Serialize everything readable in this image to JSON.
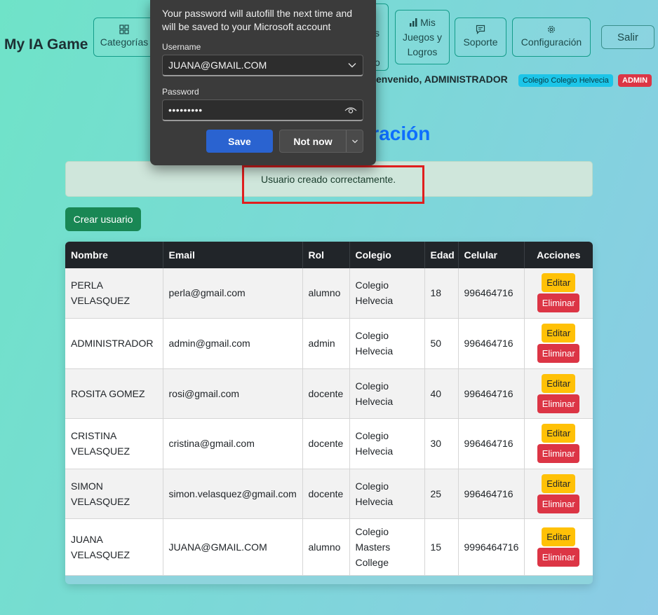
{
  "brand": "My IA Game",
  "nav": {
    "categorias": "Categorías",
    "hidden_partial_1": "s",
    "hidden_partial_2": "o",
    "mis_juegos_line1": "Mis",
    "mis_juegos_line2": "Juegos y",
    "mis_juegos_line3": "Logros",
    "soporte": "Soporte",
    "configuracion": "Configuración",
    "salir": "Salir"
  },
  "welcome": "envenido, ADMINISTRADOR",
  "badges": {
    "colegio": "Colegio Colegio Helvecia",
    "role": "ADMIN"
  },
  "page_title_partial": "tración",
  "alert": {
    "text": "Usuario creado correctamente."
  },
  "create_button": "Crear usuario",
  "table": {
    "headers": [
      "Nombre",
      "Email",
      "Rol",
      "Colegio",
      "Edad",
      "Celular",
      "Acciones"
    ],
    "edit_label": "Editar",
    "delete_label": "Eliminar",
    "rows": [
      {
        "nombre": "PERLA VELASQUEZ",
        "email": "perla@gmail.com",
        "rol": "alumno",
        "colegio": "Colegio Helvecia",
        "edad": "18",
        "celular": "996464716"
      },
      {
        "nombre": "ADMINISTRADOR",
        "email": "admin@gmail.com",
        "rol": "admin",
        "colegio": "Colegio Helvecia",
        "edad": "50",
        "celular": "996464716"
      },
      {
        "nombre": "ROSITA GOMEZ",
        "email": "rosi@gmail.com",
        "rol": "docente",
        "colegio": "Colegio Helvecia",
        "edad": "40",
        "celular": "996464716"
      },
      {
        "nombre": "CRISTINA VELASQUEZ",
        "email": "cristina@gmail.com",
        "rol": "docente",
        "colegio": "Colegio Helvecia",
        "edad": "30",
        "celular": "996464716"
      },
      {
        "nombre": "SIMON VELASQUEZ",
        "email": "simon.velasquez@gmail.com",
        "rol": "docente",
        "colegio": "Colegio Helvecia",
        "edad": "25",
        "celular": "996464716"
      },
      {
        "nombre": "JUANA VELASQUEZ",
        "email": "JUANA@GMAIL.COM",
        "rol": "alumno",
        "colegio": "Colegio Masters College",
        "edad": "15",
        "celular": "9996464716"
      }
    ]
  },
  "password_dialog": {
    "message": "Your password will autofill the next time and will be saved to your Microsoft account",
    "username_label": "Username",
    "username_value": "JUANA@GMAIL.COM",
    "password_label": "Password",
    "password_value": "•••••••••",
    "save": "Save",
    "not_now": "Not now"
  },
  "colors": {
    "primary": "#0d6efd",
    "success": "#198754",
    "warning": "#ffc107",
    "danger": "#dc3545",
    "info": "#1cc5e8",
    "dark": "#212529",
    "dialog_save": "#2a63d0"
  },
  "icons": [
    "grid-icon",
    "bar-chart-icon",
    "message-icon",
    "gear-icon",
    "chevron-down-icon",
    "eye-icon"
  ]
}
